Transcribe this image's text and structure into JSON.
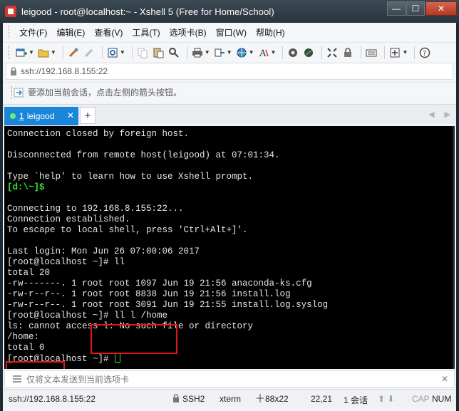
{
  "window": {
    "title": "leigood - root@localhost:~ - Xshell 5 (Free for Home/School)",
    "btn_minimize": "—",
    "btn_maximize": "☐",
    "btn_close": "✕"
  },
  "menu": {
    "items": [
      "文件(F)",
      "编辑(E)",
      "查看(V)",
      "工具(T)",
      "选项卡(B)",
      "窗口(W)",
      "帮助(H)"
    ]
  },
  "address": {
    "value": "ssh://192.168.8.155:22"
  },
  "hint": {
    "text": "要添加当前会话，点击左侧的箭头按钮。"
  },
  "tabs": {
    "active_number": "1",
    "active_label": "leigood",
    "close_glyph": "✕",
    "new_tab_glyph": "+"
  },
  "terminal": {
    "lines": [
      "Connection closed by foreign host.",
      "",
      "Disconnected from remote host(leigood) at 07:01:34.",
      "",
      "Type `help' to learn how to use Xshell prompt.",
      "[d:\\~]$",
      "",
      "Connecting to 192.168.8.155:22...",
      "Connection established.",
      "To escape to local shell, press 'Ctrl+Alt+]'.",
      "",
      "Last login: Mon Jun 26 07:00:06 2017",
      "[root@localhost ~]# ll",
      "total 20",
      "-rw-------. 1 root root 1097 Jun 19 21:56 anaconda-ks.cfg",
      "-rw-r--r--. 1 root root 8838 Jun 19 21:56 install.log",
      "-rw-r--r--. 1 root root 3091 Jun 19 21:55 install.log.syslog",
      "[root@localhost ~]# ll l /home",
      "ls: cannot access l: No such file or directory",
      "/home:",
      "total 0",
      "[root@localhost ~]# "
    ],
    "local_prompt_line_index": 5,
    "highlight_color": "#e01a1a",
    "prompt_color": "#2ee62e"
  },
  "sendbar": {
    "placeholder": "仅将文本发送到当前选项卡",
    "close_glyph": "✕"
  },
  "status": {
    "connection": "ssh://192.168.8.155:22",
    "protocol": "SSH2",
    "terminal_type": "xterm",
    "size": "88x22",
    "cursor_pos": "22,21",
    "sessions": "1 会话",
    "caps": "CAP",
    "num": "NUM"
  }
}
